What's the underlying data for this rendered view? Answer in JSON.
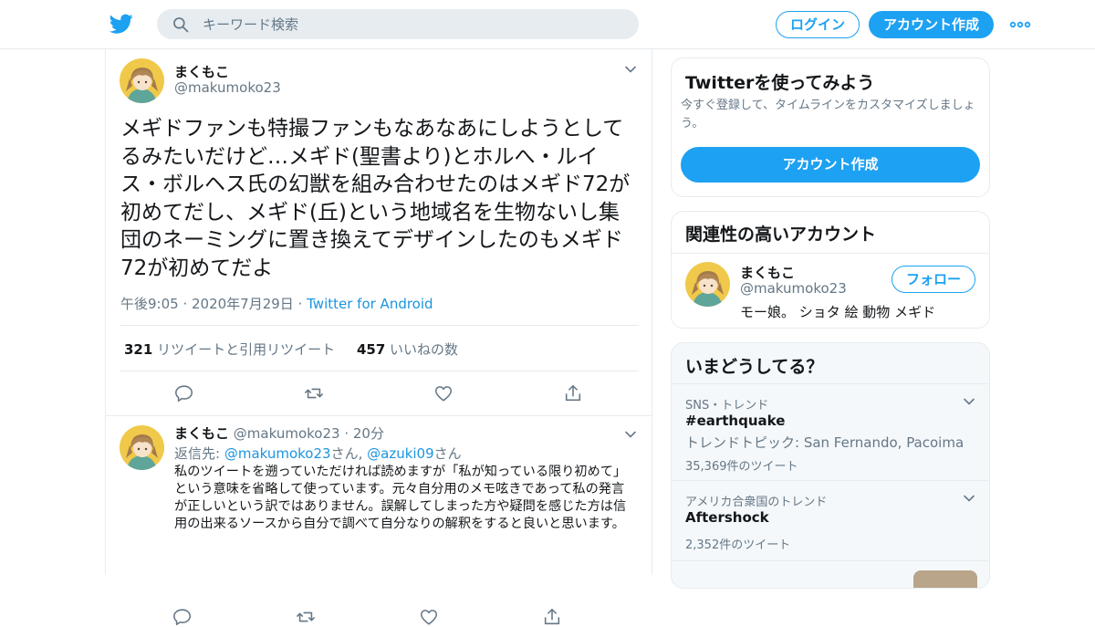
{
  "header": {
    "search_placeholder": "キーワード検索",
    "login_label": "ログイン",
    "signup_label": "アカウント作成",
    "brand_color": "#1da1f2"
  },
  "tweet": {
    "author_name": "まくもこ",
    "author_handle": "@makumoko23",
    "text": "メギドファンも特撮ファンもなあなあにしようとしてるみたいだけど…メギド(聖書より)とホルへ・ルイス・ボルヘス氏の幻獣を組み合わせたのはメギド72が初めてだし、メギド(丘)という地域名を生物ないし集団のネーミングに置き換えてデザインしたのもメギド72が初めてだよ",
    "time": "午後9:05",
    "date": "2020年7月29日",
    "source": "Twitter for Android",
    "retweet_count": "321",
    "retweet_label": "リツイートと引用リツイート",
    "like_count": "457",
    "like_label": "いいねの数"
  },
  "reply": {
    "author_name": "まくもこ",
    "author_handle": "@makumoko23",
    "age": "20分",
    "reply_prefix": "返信先: ",
    "reply_user1": "@makumoko23",
    "reply_mid": "さん, ",
    "reply_user2": "@azuki09",
    "reply_suffix": "さん",
    "text": "私のツイートを遡っていただければ読めますが「私が知っている限り初めて」という意味を省略して使っています。元々自分用のメモ呟きであって私の発言が正しいという訳ではありません。誤解してしまった方や疑問を感じた方は信用の出来るソースから自分で調べて自分なりの解釈をすると良いと思います。"
  },
  "signup_card": {
    "title": "Twitterを使ってみよう",
    "description": "今すぐ登録して、タイムラインをカスタマイズしましょう。",
    "button_label": "アカウント作成"
  },
  "related_card": {
    "title": "関連性の高いアカウント",
    "name": "まくもこ",
    "handle": "@makumoko23",
    "bio": "モー娘。 ショタ 絵 動物 メギド",
    "follow_label": "フォロー"
  },
  "trends_card": {
    "title": "いまどうしてる？",
    "items": [
      {
        "context": "SNS・トレンド",
        "title": "#earthquake",
        "subtitle": "トレンドトピック: San Fernando, Pacoima",
        "count": "35,369件のツイート"
      },
      {
        "context": "アメリカ合衆国のトレンド",
        "title": "Aftershock",
        "count": "2,352件のツイート"
      }
    ]
  }
}
